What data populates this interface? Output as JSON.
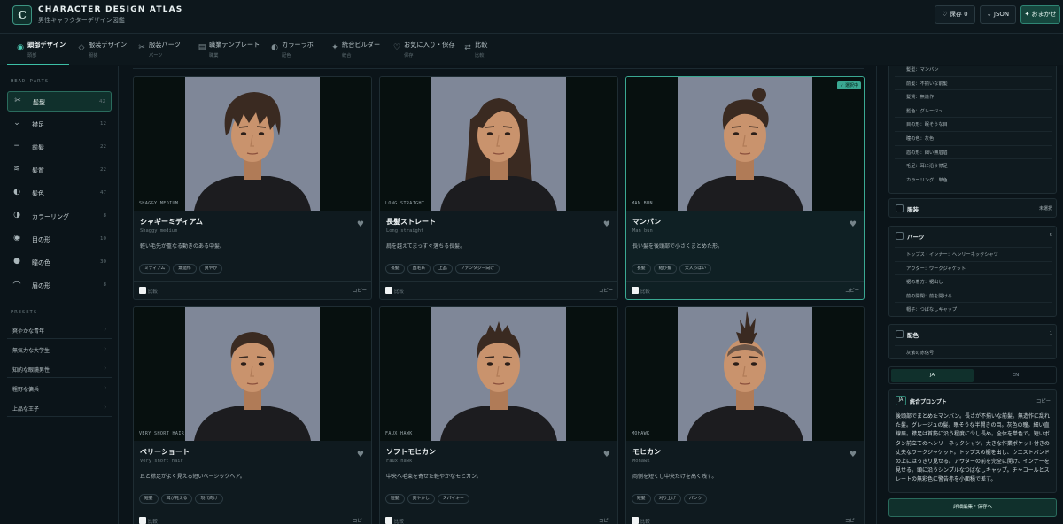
{
  "app": {
    "title": "CHARACTER DESIGN ATLAS",
    "subtitle": "男性キャラクターデザイン図鑑",
    "logo_letter": "C"
  },
  "header_buttons": {
    "save": "♡ 保存 0",
    "json": "↓ JSON",
    "omakase": "✦ おまかせ"
  },
  "tabs": [
    {
      "label": "頭部デザイン",
      "sub": "頭部",
      "icon": "target-icon",
      "active": true
    },
    {
      "label": "服装デザイン",
      "sub": "服装",
      "icon": "diamond-icon",
      "active": false
    },
    {
      "label": "服装パーツ",
      "sub": "パーツ",
      "icon": "scissors-icon",
      "active": false
    },
    {
      "label": "職業テンプレート",
      "sub": "職業",
      "icon": "grid-icon",
      "active": false
    },
    {
      "label": "カラーラボ",
      "sub": "配色",
      "icon": "contrast-icon",
      "active": false
    },
    {
      "label": "統合ビルダー",
      "sub": "統合",
      "icon": "sparkle-icon",
      "active": false
    },
    {
      "label": "お気に入り・保存",
      "sub": "保存",
      "icon": "heart-icon",
      "active": false
    },
    {
      "label": "比較",
      "sub": "比較",
      "icon": "swap-icon",
      "active": false
    }
  ],
  "sidebar": {
    "parts_header": "HEAD PARTS",
    "parts": [
      {
        "label": "髪型",
        "count": "42",
        "icon": "scissors-icon",
        "active": true
      },
      {
        "label": "襟足",
        "count": "12",
        "icon": "chevron-down-icon",
        "active": false
      },
      {
        "label": "前髪",
        "count": "22",
        "icon": "minus-icon",
        "active": false
      },
      {
        "label": "髪質",
        "count": "22",
        "icon": "wave-icon",
        "active": false
      },
      {
        "label": "髪色",
        "count": "47",
        "icon": "half-circle-icon",
        "active": false
      },
      {
        "label": "カラーリング",
        "count": "8",
        "icon": "half-circle-icon",
        "active": false
      },
      {
        "label": "目の形",
        "count": "10",
        "icon": "eye-icon",
        "active": false
      },
      {
        "label": "瞳の色",
        "count": "30",
        "icon": "dot-icon",
        "active": false
      },
      {
        "label": "眉の形",
        "count": "8",
        "icon": "arc-icon",
        "active": false
      }
    ],
    "presets_header": "PRESETS",
    "presets": [
      "爽やかな青年",
      "無気力な大学生",
      "知的な眼鏡男性",
      "粗野な傭兵",
      "上品な王子"
    ]
  },
  "cards": [
    {
      "title": "シャギーミディアム",
      "sub": "Shaggy medium",
      "caption": "SHAGGY MEDIUM",
      "desc": "軽い毛先が重なる動きのある中髪。",
      "tags": [
        "ミディアム",
        "無造作",
        "爽やか"
      ],
      "hair": "shaggy",
      "selected": false
    },
    {
      "title": "長髪ストレート",
      "sub": "Long straight",
      "caption": "LONG STRAIGHT",
      "desc": "肩を越えてまっすぐ落ちる長髪。",
      "tags": [
        "長髪",
        "直毛系",
        "上品",
        "ファンタジー向け"
      ],
      "hair": "long",
      "selected": false
    },
    {
      "title": "マンバン",
      "sub": "Man bun",
      "caption": "MAN BUN",
      "desc": "長い髪を後頭部で小さくまとめた形。",
      "tags": [
        "長髪",
        "結び髪",
        "大人っぽい"
      ],
      "hair": "bun",
      "selected": true,
      "badge": "✓ 選択中"
    },
    {
      "title": "ベリーショート",
      "sub": "Very short hair",
      "caption": "VERY SHORT HAIR",
      "desc": "耳と襟足がよく見える短いベーシックヘア。",
      "tags": [
        "短髪",
        "耳が見える",
        "現代向け"
      ],
      "hair": "veryshort",
      "selected": false
    },
    {
      "title": "ソフトモヒカン",
      "sub": "Faux hawk",
      "caption": "FAUX HAWK",
      "desc": "中央へ毛束を寄せた軽やかなモヒカン。",
      "tags": [
        "短髪",
        "爽やかし",
        "スパイキー"
      ],
      "hair": "fauxhawk",
      "selected": false
    },
    {
      "title": "モヒカン",
      "sub": "Mohawk",
      "caption": "MOHAWK",
      "desc": "両側を短くし中央だけを高く残す。",
      "tags": [
        "短髪",
        "刈り上げ",
        "パンク"
      ],
      "hair": "mohawk",
      "selected": false
    }
  ],
  "card_labels": {
    "compare": "比較",
    "copy": "コピー"
  },
  "right_panel": {
    "head_items": [
      "髪型：マンバン",
      "前髪：不揃いな前髪",
      "髪質：無造作",
      "髪色：グレージュ",
      "目の形：眠そうな目",
      "瞳の色：灰色",
      "眉の形：細い無眉眉",
      "毛足：耳に沿う襟足",
      "カラーリング：単色"
    ],
    "clothing": {
      "title": "服装",
      "count": "未選択"
    },
    "parts": {
      "title": "パーツ",
      "count": "5",
      "items": [
        "トップス・インナー：ヘンリーネックシャツ",
        "アウター：ワークジャケット",
        "裾の着方：裾出し",
        "前の開閉：前を開ける",
        "帽子：つばなしキャップ"
      ]
    },
    "color": {
      "title": "配色",
      "count": "1",
      "items": [
        "灰紫の赤信号"
      ]
    },
    "lang_tabs": [
      "JA",
      "EN"
    ],
    "prompt": {
      "badge": "JA",
      "title": "統合プロンプト",
      "copy": "コピー",
      "text": "後頭部でまとめたマンバン。長さが不揃いな前髪。無造作に乱れた髪。グレージュの髪。眠そうな半開きの目。灰色の瞳。細い直線眉。襟足は首筋に沿う程度に少し長め。全体を単色で。短いボタン前立てのヘンリーネックシャツ。大きな作業ポケット付きの丈夫なワークジャケット。トップスの裾を出し、ウエストバンドの上にはっきり見せる。アウターの前を完全に開け、インナーを見せる。頭に沿うシンプルなつばなしキャップ。チャコールとスレートの無彩色に警告赤を小面積で差す。"
    },
    "detail_button": "詳細編集・保存へ"
  }
}
